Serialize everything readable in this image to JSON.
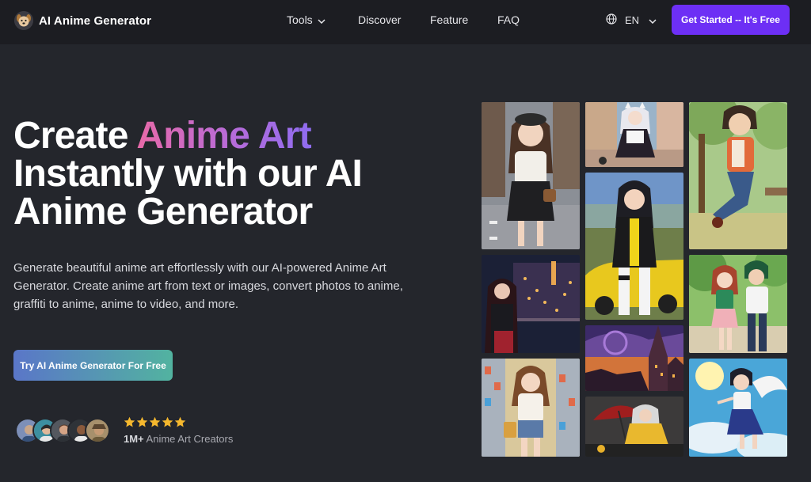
{
  "nav": {
    "brand": "AI Anime Generator",
    "links": [
      "Tools",
      "Discover",
      "Feature",
      "FAQ"
    ],
    "language": "EN",
    "cta": "Get Started -- It's Free"
  },
  "hero": {
    "title_line1_plain": "Create ",
    "title_line1_highlight": "Anime Art",
    "title_line2": "Instantly with our AI",
    "title_line3": "Anime Generator",
    "description": "Generate beautiful anime art effortlessly with our AI-powered Anime Art Generator. Create anime art from text or images, convert photos to anime, graffiti to anime, anime to video, and more.",
    "cta": "Try AI Anime Generator For Free"
  },
  "social_proof": {
    "rating": 5,
    "count": "1M+",
    "label": " Anime Art Creators"
  },
  "colors": {
    "background": "#24262c",
    "nav_background": "#1c1d22",
    "primary_button": "#6d2ff5",
    "gradient_start": "#e86aa8",
    "gradient_end": "#8f6cf0",
    "cta_gradient_start": "#5a76c8",
    "cta_gradient_end": "#52b3a0",
    "star": "#f5b82e"
  },
  "gallery": [
    {
      "name": "gallery-image-girl-city-street"
    },
    {
      "name": "gallery-image-cat-girl-maid"
    },
    {
      "name": "gallery-image-boy-sitting-park"
    },
    {
      "name": "gallery-image-racer-girl-car"
    },
    {
      "name": "gallery-image-girl-night-city"
    },
    {
      "name": "gallery-image-couple-walking"
    },
    {
      "name": "gallery-image-fantasy-castle-sunset"
    },
    {
      "name": "gallery-image-girl-supermarket"
    },
    {
      "name": "gallery-image-samurai-umbrella"
    },
    {
      "name": "gallery-image-girl-flying-sky"
    }
  ]
}
